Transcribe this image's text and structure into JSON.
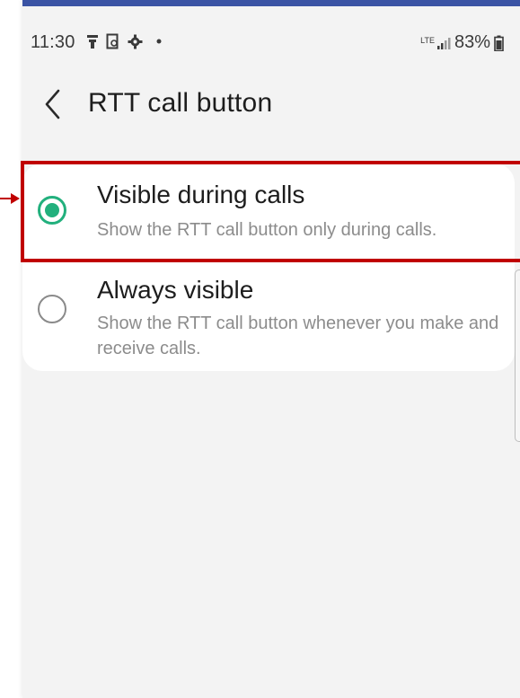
{
  "status_bar": {
    "time": "11:30",
    "left_icons": [
      "notification-icon",
      "screenshot-icon",
      "settings-gear-icon",
      "dot-icon"
    ],
    "network": "LTE",
    "battery_percent": "83%"
  },
  "header": {
    "back_icon": "chevron-left-icon",
    "title": "RTT call button"
  },
  "options": [
    {
      "title": "Visible during calls",
      "description": "Show the RTT call button only during calls.",
      "selected": true
    },
    {
      "title": "Always visible",
      "description": "Show the RTT call button whenever you make and receive calls.",
      "selected": false
    }
  ],
  "colors": {
    "accent_green": "#22b07d",
    "highlight_red": "#c00000",
    "top_bar_blue": "#3a53a4",
    "background": "#f3f3f3"
  }
}
